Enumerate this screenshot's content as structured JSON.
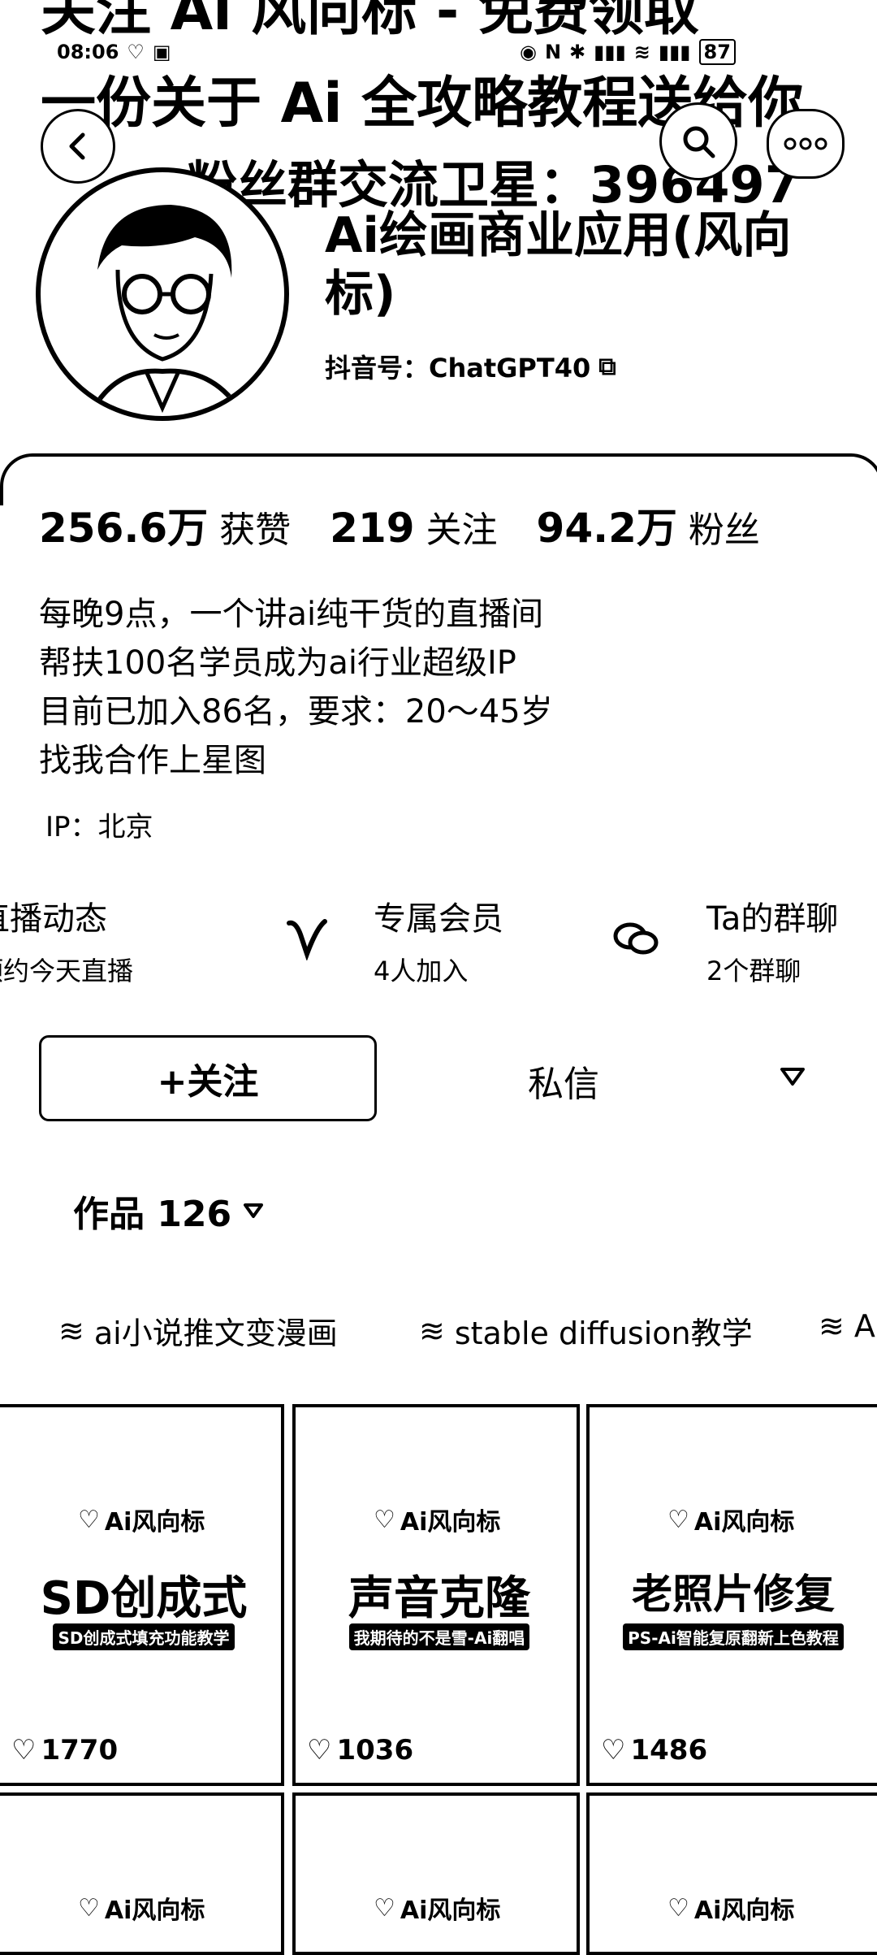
{
  "status_bar": {
    "time": "08:06",
    "battery": "87"
  },
  "banner": {
    "line1": "关注 Ai 风向标 - 免费领取",
    "line2": "一份关于 Ai 全攻略教程送给你",
    "line3": "粉丝群交流卫星：396497"
  },
  "profile": {
    "name": "Ai绘画商业应用(风向标)",
    "douyin_id": "抖音号：ChatGPT40"
  },
  "stats": {
    "likes_value": "256.6万",
    "likes_label": "获赞",
    "following_value": "219",
    "following_label": "关注",
    "fans_value": "94.2万",
    "fans_label": "粉丝"
  },
  "bio": {
    "lines": [
      "每晚9点，一个讲ai纯干货的直播间",
      "帮扶100名学员成为ai行业超级IP",
      "目前已加入86名，要求：20～45岁",
      "找我合作上星图"
    ],
    "ip": "IP：北京"
  },
  "features": [
    {
      "title": "直播动态",
      "sub": "预约今天直播"
    },
    {
      "title": "专属会员",
      "sub": "4人加入"
    },
    {
      "title": "Ta的群聊",
      "sub": "2个群聊"
    }
  ],
  "actions": {
    "follow": "+关注",
    "message": "私信"
  },
  "works": {
    "label": "作品 126"
  },
  "collections": [
    "ai小说推文变漫画",
    "stable diffusion教学",
    "A"
  ],
  "tiles": [
    {
      "brand": "Ai风向标",
      "title": "SD创成式",
      "subtitle": "SD创成式填充功能教学",
      "likes": "1770"
    },
    {
      "brand": "Ai风向标",
      "title": "声音克隆",
      "subtitle": "我期待的不是雪-Ai翻唱",
      "likes": "1036"
    },
    {
      "brand": "Ai风向标",
      "title": "老照片修复",
      "subtitle": "PS-Ai智能复原翻新上色教程",
      "likes": "1486"
    },
    {
      "brand": "Ai风向标"
    },
    {
      "brand": "Ai风向标"
    },
    {
      "brand": "Ai风向标"
    }
  ]
}
